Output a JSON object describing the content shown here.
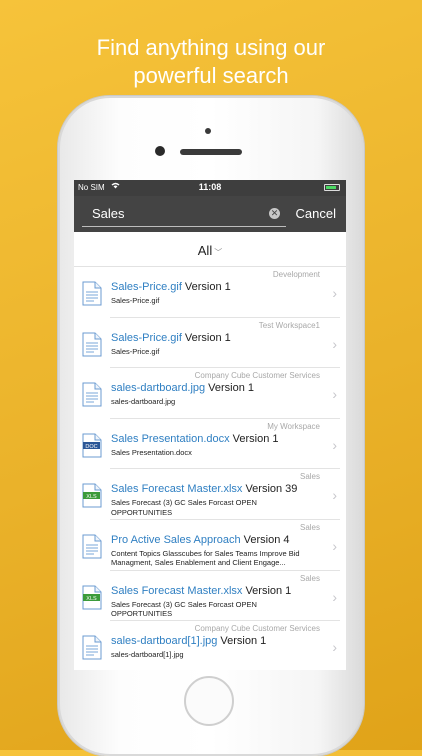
{
  "headline": {
    "line1": "Find anything using our",
    "line2": "powerful search"
  },
  "status": {
    "carrier": "No SIM",
    "wifi": "wifi-icon",
    "time": "11:08",
    "battery_level": 0.8
  },
  "search": {
    "value": "Sales",
    "cancel_label": "Cancel",
    "clear_icon": "clear-icon"
  },
  "filter": {
    "label": "All",
    "chevron": "chevron-down-icon"
  },
  "results": [
    {
      "workspace": "Development",
      "title": "Sales-Price.gif",
      "version": "Version 1",
      "subtitle": "Sales-Price.gif",
      "icon": "generic-document-icon"
    },
    {
      "workspace": "Test Workspace1",
      "title": "Sales-Price.gif",
      "version": "Version 1",
      "subtitle": "Sales-Price.gif",
      "icon": "generic-document-icon"
    },
    {
      "workspace": "Company Cube Customer Services",
      "title": "sales-dartboard.jpg",
      "version": "Version 1",
      "subtitle": "sales-dartboard.jpg",
      "icon": "generic-document-icon"
    },
    {
      "workspace": "My Workspace",
      "title": "Sales Presentation.docx",
      "version": "Version 1",
      "subtitle": "Sales Presentation.docx",
      "icon": "doc-icon"
    },
    {
      "workspace": "Sales",
      "title": "Sales Forecast Master.xlsx",
      "version": "Version 39",
      "subtitle": "Sales Forecast (3) GC Sales Forcast OPEN OPPORTUNITIES",
      "icon": "xls-icon"
    },
    {
      "workspace": "Sales",
      "title": "Pro Active Sales Approach",
      "version": "Version 4",
      "subtitle": "Content Topics Glasscubes for Sales Teams   Improve Bid Managment, Sales Enablement and Client Engage...",
      "icon": "generic-document-icon"
    },
    {
      "workspace": "Sales",
      "title": "Sales Forecast Master.xlsx",
      "version": "Version 1",
      "subtitle": "Sales Forecast (3) GC Sales Forcast OPEN OPPORTUNITIES",
      "icon": "xls-icon"
    },
    {
      "workspace": "Company Cube Customer Services",
      "title": "sales-dartboard[1].jpg",
      "version": "Version 1",
      "subtitle": "sales-dartboard[1].jpg",
      "icon": "generic-document-icon"
    }
  ],
  "icon_labels": {
    "doc": "DOC",
    "xls": "XLS"
  },
  "colors": {
    "accent": "#2f7fc2",
    "background": "#f3bd33",
    "toolbar": "#444444"
  }
}
